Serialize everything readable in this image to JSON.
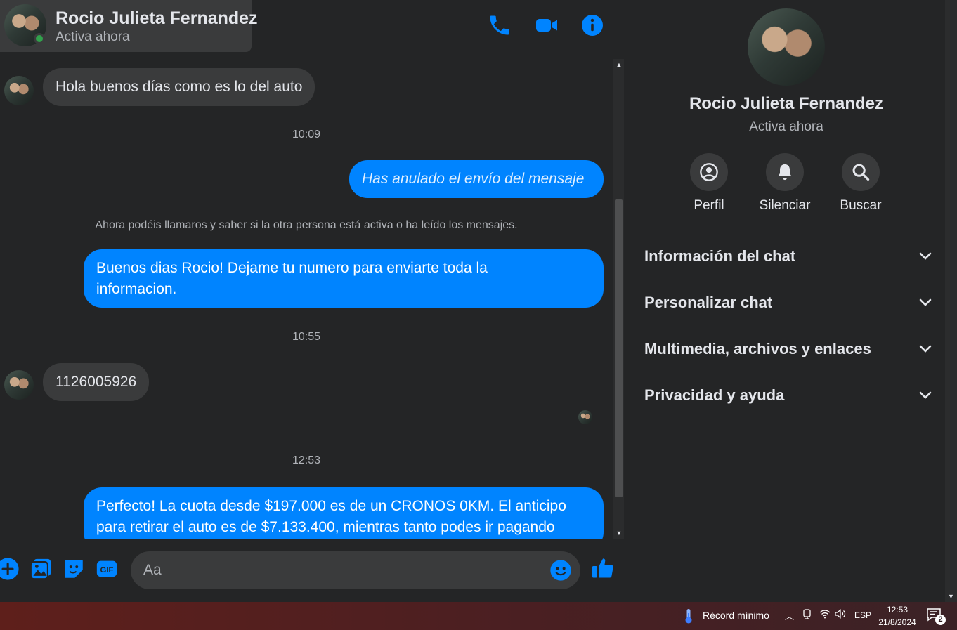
{
  "contact": {
    "name": "Rocio Julieta Fernandez",
    "status": "Activa ahora"
  },
  "header_icons": [
    "phone-icon",
    "video-camera-icon",
    "info-icon"
  ],
  "messages": {
    "m1": "Hola buenos días como es lo del auto",
    "ts1": "10:09",
    "m2_unsent": "Has anulado el envío del mensaje",
    "notice": "Ahora podéis llamaros y saber si la otra persona está activa o ha leído los mensajes.",
    "m3_line1": "Buenos dias Rocio! Dejame tu numero para enviarte toda la",
    "m3_line2": "informacion.",
    "ts2": "10:55",
    "m4": "1126005926",
    "ts3": "12:53",
    "m5_line1": "Perfecto! La cuota desde $197.000 es de un CRONOS 0KM. El anticipo",
    "m5_line2": "para retirar el auto es de $7.133.400, mientras tanto podes ir pagando"
  },
  "composer": {
    "placeholder": "Aa",
    "icons": [
      "add-icon",
      "photo-icon",
      "sticker-icon",
      "gif-icon",
      "emoji-icon",
      "like-icon"
    ],
    "gif_label": "GIF"
  },
  "side_panel": {
    "name": "Rocio Julieta Fernandez",
    "status": "Activa ahora",
    "actions": [
      {
        "label": "Perfil",
        "icon": "profile-icon"
      },
      {
        "label": "Silenciar",
        "icon": "bell-icon"
      },
      {
        "label": "Buscar",
        "icon": "search-icon"
      }
    ],
    "sections": [
      {
        "label": "Información del chat"
      },
      {
        "label": "Personalizar chat"
      },
      {
        "label": "Multimedia, archivos y enlaces"
      },
      {
        "label": "Privacidad y ayuda"
      }
    ]
  },
  "taskbar": {
    "weather_text": "Récord mínimo",
    "language": "ESP",
    "time": "12:53",
    "date": "21/8/2024",
    "notification_count": "2"
  },
  "colors": {
    "accent": "#0084ff",
    "background": "#242526",
    "bubble_in": "#3a3b3c",
    "online": "#31a24c"
  }
}
